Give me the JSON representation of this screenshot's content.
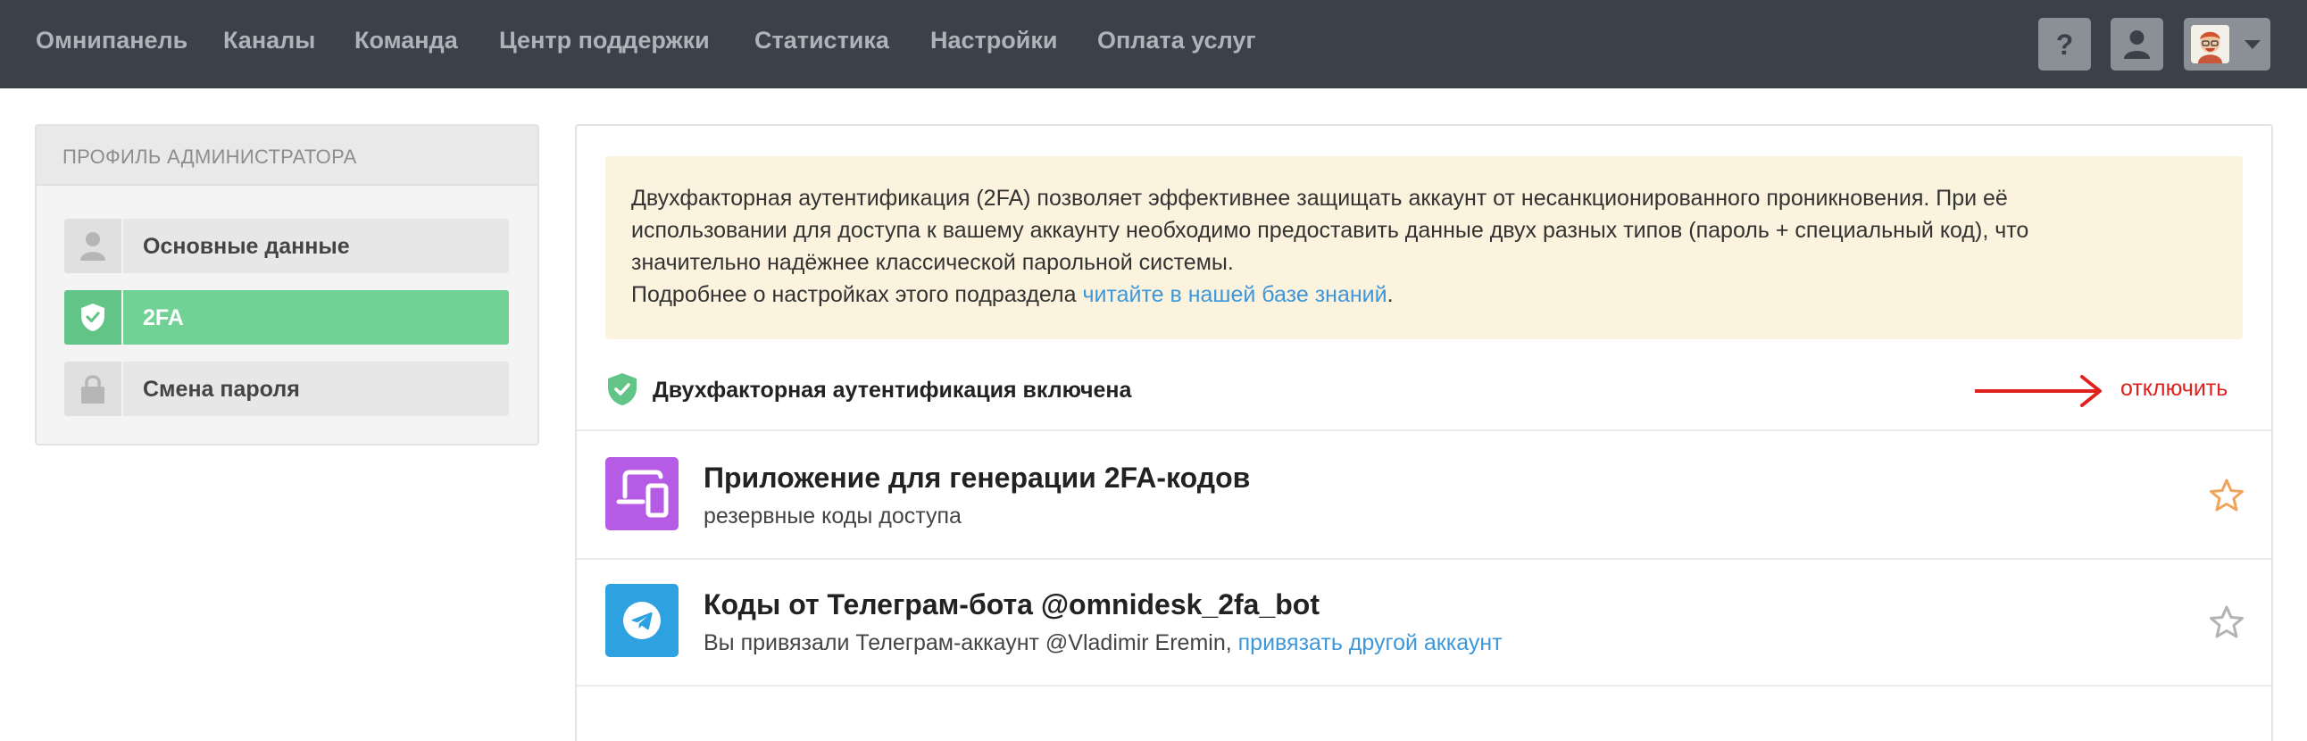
{
  "nav": {
    "items": [
      {
        "label": "Омнипанель"
      },
      {
        "label": "Каналы"
      },
      {
        "label": "Команда"
      },
      {
        "label": "Центр поддержки"
      },
      {
        "label": "Статистика"
      },
      {
        "label": "Настройки"
      },
      {
        "label": "Оплата услуг"
      }
    ],
    "help_label": "?"
  },
  "sidebar": {
    "title": "ПРОФИЛЬ АДМИНИСТРАТОРА",
    "items": [
      {
        "label": "Основные данные",
        "icon": "person-icon",
        "active": false
      },
      {
        "label": "2FA",
        "icon": "shield-check-icon",
        "active": true
      },
      {
        "label": "Смена пароля",
        "icon": "lock-icon",
        "active": false
      }
    ]
  },
  "info": {
    "line1": "Двухфакторная аутентификация (2FA) позволяет эффективнее защищать аккаунт от несанкционированного проникновения. При её",
    "line2": "использовании для доступа к вашему аккаунту необходимо предоставить данные двух разных типов (пароль + специальный код), что",
    "line3": "значительно надёжнее классической парольной системы.",
    "line4_prefix": "Подробнее о настройках этого подраздела ",
    "line4_link": "читайте в нашей базе знаний",
    "line4_suffix": "."
  },
  "status": {
    "text": "Двухфакторная аутентификация включена",
    "disable_label": "отключить"
  },
  "methods": [
    {
      "title": "Приложение для генерации 2FA-кодов",
      "link": "резервные коды доступа",
      "icon": "devices-icon",
      "icon_color": "#b65be6",
      "starred": true
    },
    {
      "title": "Коды от Телеграм-бота @omnidesk_2fa_bot",
      "text_prefix": "Вы привязали Телеграм-аккаунт @Vladimir Eremin, ",
      "link": "привязать другой аккаунт",
      "icon": "telegram-icon",
      "icon_color": "#2ea2e0",
      "starred": false
    }
  ],
  "colors": {
    "topbar": "#3b4148",
    "active_green": "#72d296",
    "link_blue": "#3d97d8",
    "danger_red": "#e0211d",
    "star_orange": "#f0a35a",
    "info_bg": "#fcf3de"
  }
}
